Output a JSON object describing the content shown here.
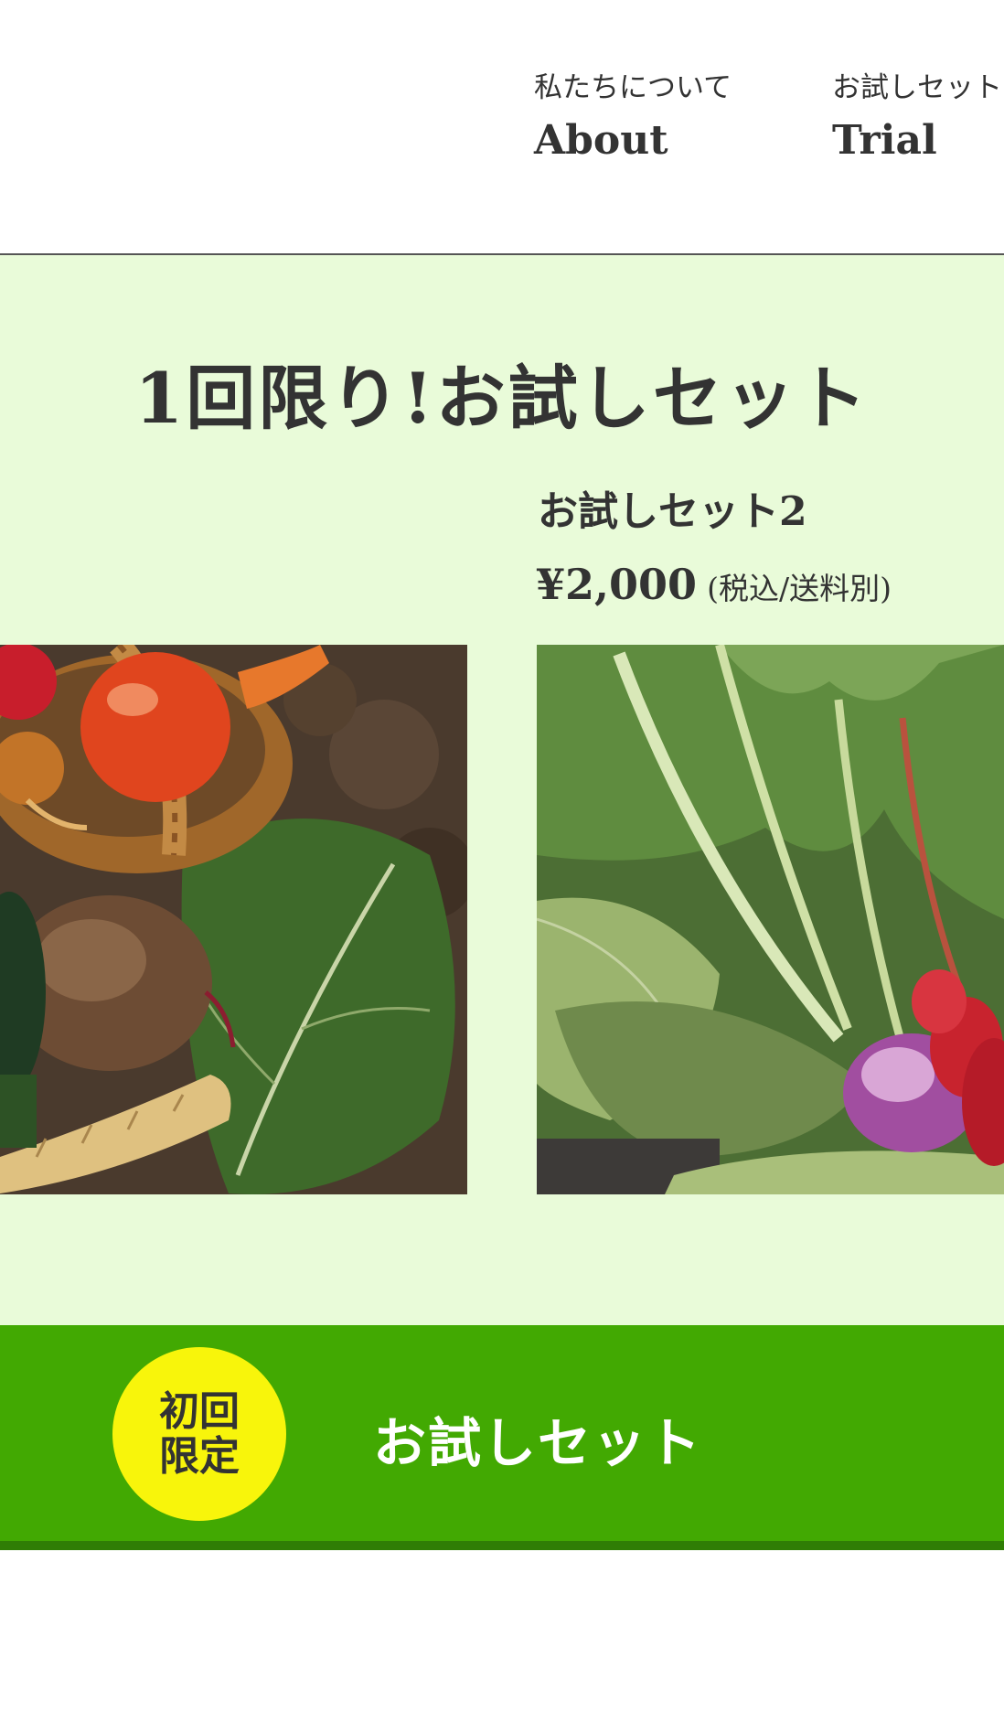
{
  "nav": {
    "items": [
      {
        "jp": "私たちについて",
        "en": "About"
      },
      {
        "jp": "お試しセット",
        "en": "Trial"
      }
    ]
  },
  "section": {
    "title": "1回限り!お試しセット"
  },
  "product": {
    "name": "お試しセット2",
    "price": "¥2,000",
    "price_note": "(税込/送料別)"
  },
  "images": [
    {
      "icon": "vegetable-basket-photo"
    },
    {
      "icon": "leafy-greens-radish-photo"
    }
  ],
  "cta": {
    "badge": "初回限定",
    "label": "お試しセット",
    "colors": {
      "background": "#42a902",
      "badge": "#f8f50b"
    }
  }
}
